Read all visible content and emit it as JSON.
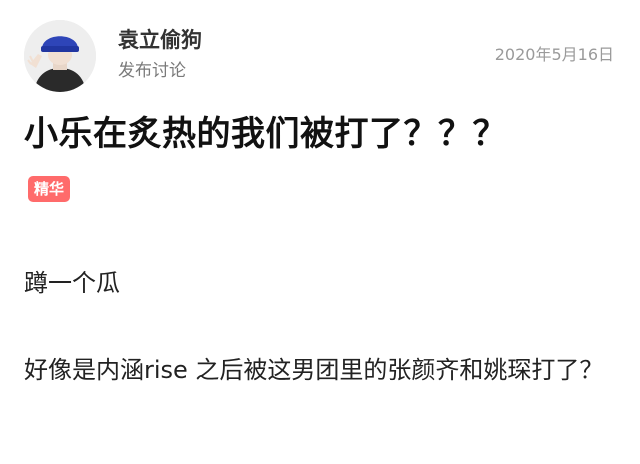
{
  "author": {
    "name": "袁立偷狗",
    "action": "发布讨论"
  },
  "post": {
    "date": "2020年5月16日",
    "title": "小乐在炙热的我们被打了？？？",
    "badge": "精华",
    "paragraphs": [
      "蹲一个瓜",
      "好像是内涵rise 之后被这男团里的张颜齐和姚琛打了？"
    ]
  },
  "colors": {
    "badge_bg": "#ff6b6b",
    "avatar_hat": "#2e45b8"
  }
}
